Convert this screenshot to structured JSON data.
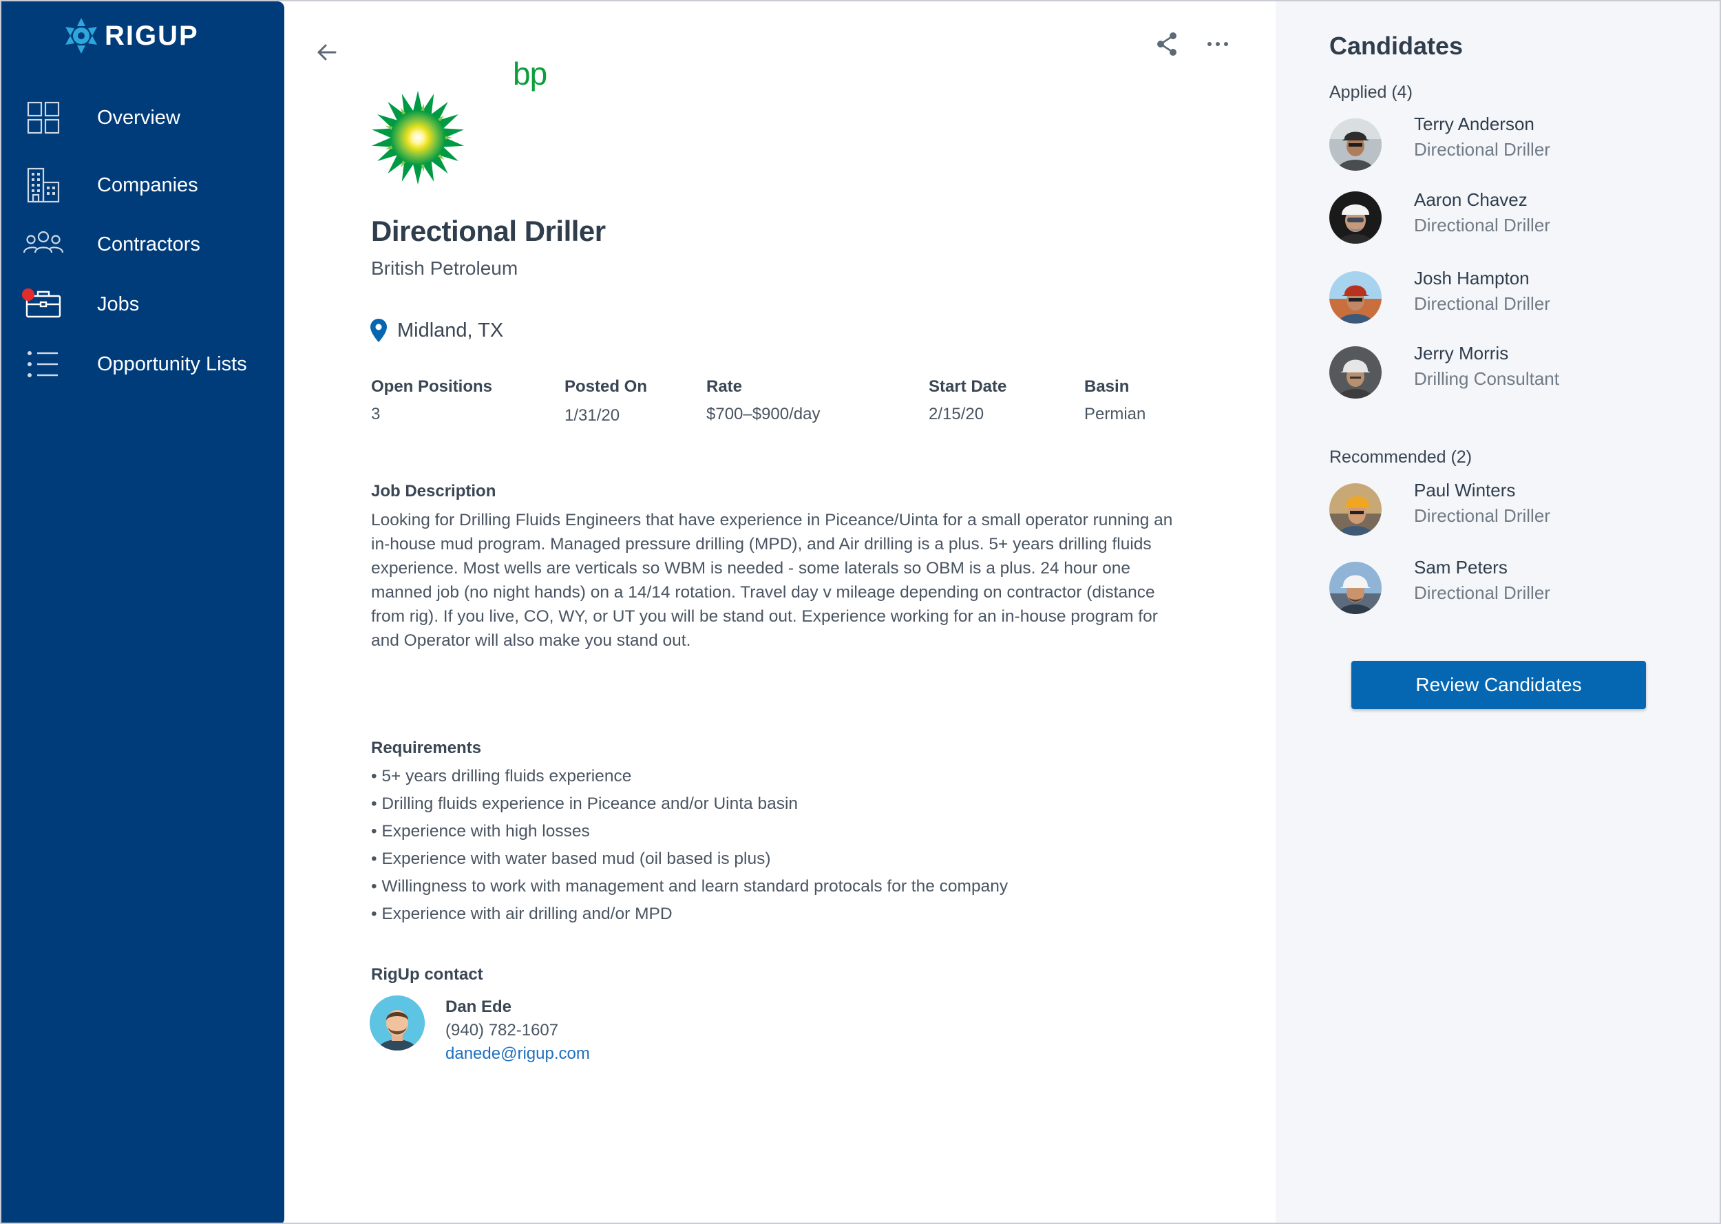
{
  "brand": {
    "name": "RIGUP"
  },
  "sidebar": {
    "items": [
      {
        "label": "Overview",
        "icon": "grid-icon"
      },
      {
        "label": "Companies",
        "icon": "building-icon"
      },
      {
        "label": "Contractors",
        "icon": "people-icon"
      },
      {
        "label": "Jobs",
        "icon": "briefcase-icon",
        "notification": true
      },
      {
        "label": "Opportunity Lists",
        "icon": "list-icon"
      }
    ]
  },
  "job": {
    "logo_text": "bp",
    "title": "Directional Driller",
    "company": "British Petroleum",
    "location": "Midland, TX",
    "meta": [
      {
        "label": "Open Positions",
        "value": "3"
      },
      {
        "label": "Posted On",
        "value": "1/31/20"
      },
      {
        "label": "Rate",
        "value": "$700–$900/day"
      },
      {
        "label": "Start Date",
        "value": "2/15/20"
      },
      {
        "label": "Basin",
        "value": "Permian"
      }
    ],
    "description_label": "Job Description",
    "description": "Looking for Drilling Fluids Engineers that have experience in Piceance/Uinta for a small operator running an in-house mud program. Managed pressure drilling (MPD), and Air drilling is a plus. 5+ years drilling fluids experience. Most wells are verticals so WBM is needed - some laterals so OBM is a plus. 24 hour one manned job (no night hands) on a 14/14 rotation. Travel day v mileage depending on contractor (distance from rig). If you live, CO, WY, or UT you will be stand out. Experience working for an in-house program for and Operator will also make you stand out.",
    "requirements_label": "Requirements",
    "requirements": [
      "• 5+ years drilling fluids experience",
      "• Drilling fluids experience in Piceance and/or Uinta basin",
      "• Experience with high losses",
      "• Experience with water based mud (oil based is plus)",
      "• Willingness to work with management and learn standard protocals for the company",
      "• Experience with air drilling and/or MPD"
    ],
    "contact_label": "RigUp contact",
    "contact": {
      "name": "Dan Ede",
      "phone": "(940) 782-1607",
      "email": "danede@rigup.com"
    }
  },
  "candidates": {
    "title": "Candidates",
    "applied_label": "Applied (4)",
    "applied": [
      {
        "name": "Terry Anderson",
        "role": "Directional Driller"
      },
      {
        "name": "Aaron Chavez",
        "role": "Directional Driller"
      },
      {
        "name": "Josh Hampton",
        "role": "Directional Driller"
      },
      {
        "name": "Jerry Morris",
        "role": "Drilling Consultant"
      }
    ],
    "recommended_label": "Recommended (2)",
    "recommended": [
      {
        "name": "Paul Winters",
        "role": "Directional Driller"
      },
      {
        "name": "Sam Peters",
        "role": "Directional Driller"
      }
    ],
    "review_button": "Review Candidates"
  },
  "colors": {
    "sidebar": "#003b7a",
    "accent": "#0567b2",
    "notification": "#e32d2d",
    "bp_green": "#0b9e3b",
    "panel_bg": "#f4f6fa"
  }
}
